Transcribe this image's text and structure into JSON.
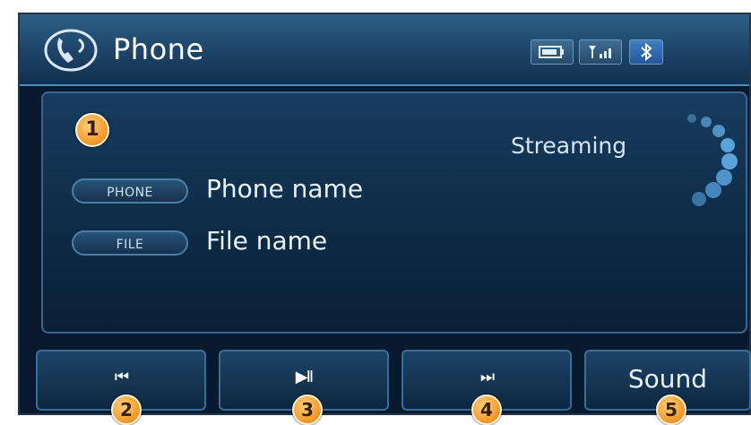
{
  "header": {
    "title": "Phone",
    "status_icons": [
      "battery-icon",
      "signal-icon",
      "bluetooth-icon"
    ]
  },
  "main": {
    "callout": "1",
    "status_text": "Streaming",
    "fields": [
      {
        "tag": "PHONE",
        "value": "Phone name"
      },
      {
        "tag": "FILE",
        "value": "File name"
      }
    ]
  },
  "controls": [
    {
      "icon": "previous-track-icon",
      "glyph": "⏮",
      "callout": "2"
    },
    {
      "icon": "play-pause-icon",
      "glyph": "▶II",
      "callout": "3"
    },
    {
      "icon": "next-track-icon",
      "glyph": "⏭",
      "callout": "4"
    },
    {
      "label": "Sound",
      "callout": "5"
    }
  ],
  "colors": {
    "background": "#0a1a2e",
    "accent": "#4a8dbb",
    "callout": "#f39a2a"
  }
}
